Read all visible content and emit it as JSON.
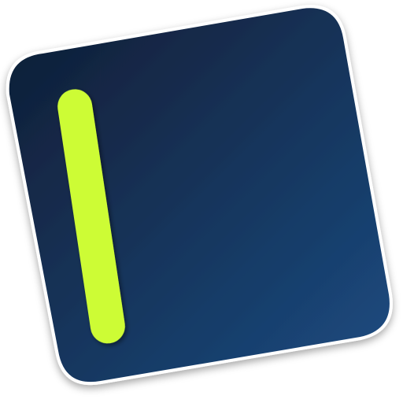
{
  "icon": {
    "name": "app-icon",
    "shape": "rounded-square, tilted",
    "glyph": "vertical-bar-icon",
    "colors": {
      "background_top_left": "#0f1c33",
      "background_bottom_right": "#1c4c82",
      "bar": "#cdfc36",
      "border": "#ffffff"
    }
  }
}
